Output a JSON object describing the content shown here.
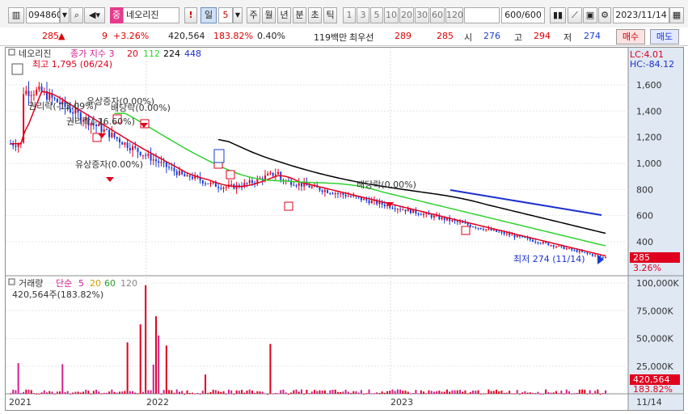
{
  "toolbar": {
    "code": "094860",
    "badge": "중",
    "name": "네오리진",
    "period_day": "일",
    "period_n": "5",
    "periods": [
      "주",
      "월",
      "년",
      "분",
      "초",
      "틱"
    ],
    "numbers": [
      "1",
      "3",
      "5",
      "10",
      "20",
      "30",
      "60",
      "120"
    ],
    "count": "600/600",
    "date": "2023/11/14"
  },
  "quote": {
    "price": "285",
    "arrow": "▲",
    "change": "9",
    "change_pct": "+3.26%",
    "volume": "420,564",
    "volume_pct": "183.82%",
    "turnover": "0.40%",
    "amount": "119백만",
    "best_label": "최우선",
    "ask": "289",
    "bid": "285",
    "open_label": "시",
    "open": "276",
    "high_label": "고",
    "high": "294",
    "low_label": "저",
    "low": "274",
    "buy_label": "매수",
    "sell_label": "매도"
  },
  "price_panel": {
    "legend_name": "네오리진",
    "legend_ma": "종가 지수 3",
    "ma": [
      "20",
      "112",
      "224",
      "448"
    ],
    "lc": "LC:4.01",
    "hc": "HC:-84.12",
    "max_note": "최고 1,795 (06/24)",
    "min_note": "최저 274 (11/14)",
    "annotations": [
      "유상증자(0.00%)",
      "권리락(-13.09%)",
      "배당락(0.00%)",
      "권리락(-16.60%)",
      "유상증자(0.00%)",
      "배당락(0.00%)"
    ],
    "yticks": [
      "1,600",
      "1,400",
      "1,200",
      "1,000",
      "800",
      "600",
      "400"
    ],
    "cur_price": "285",
    "cur_pct": "3.26%",
    "colors": {
      "ma20": "#e0001e",
      "ma112": "#2fd22f",
      "ma224": "#000000",
      "ma448": "#1a2fd0",
      "candle_up": "#e0001e",
      "candle_down": "#1a3cd0"
    }
  },
  "volume_panel": {
    "legend_name": "거래량",
    "legend_ma": "단순",
    "ma": [
      "5",
      "20",
      "60",
      "120"
    ],
    "current": "420,564주(183.82%)",
    "yticks": [
      "100,000K",
      "75,000K",
      "50,000K",
      "25,000K"
    ],
    "cur_value": "420,564",
    "cur_pct": "183.82%"
  },
  "xaxis": {
    "labels": [
      "2021",
      "2022",
      "2023"
    ],
    "last": "11/14"
  }
}
